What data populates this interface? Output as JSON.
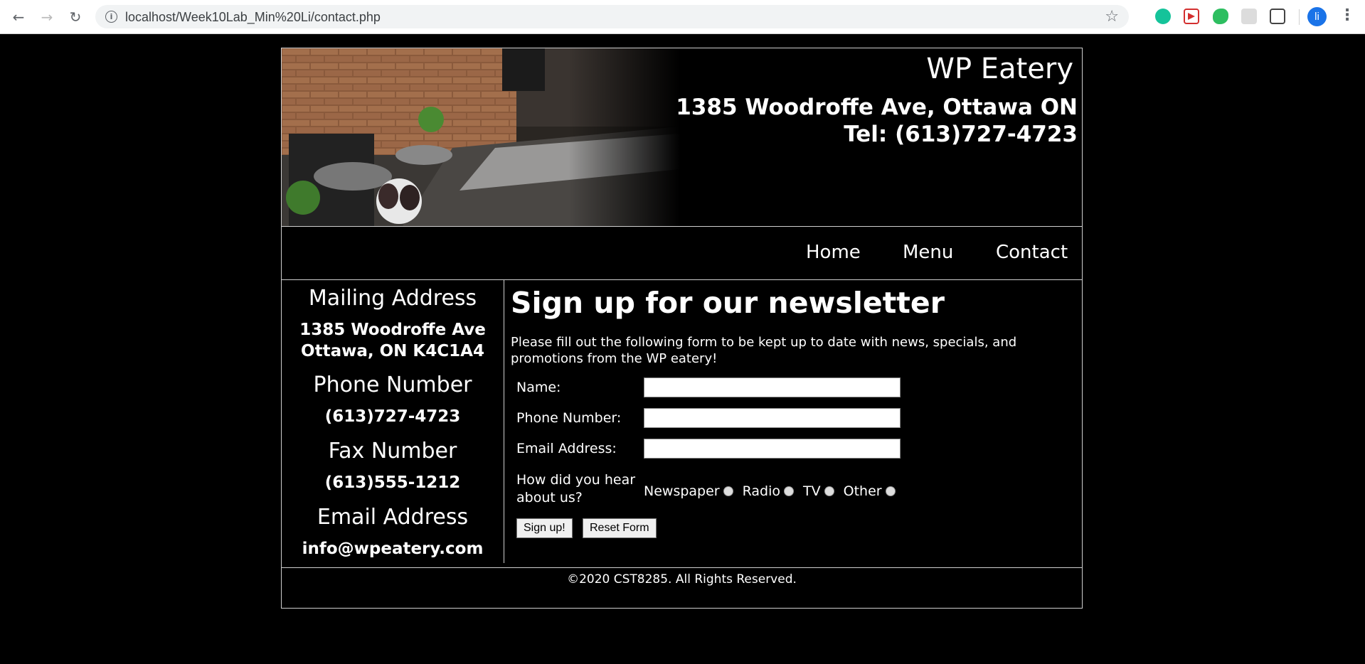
{
  "browser": {
    "url": "localhost/Week10Lab_Min%20Li/contact.php",
    "profile_initial": "li"
  },
  "header": {
    "brand": "WP Eatery",
    "address": "1385 Woodroffe Ave, Ottawa ON",
    "tel": "Tel: (613)727-4723"
  },
  "nav": {
    "items": [
      {
        "label": "Home"
      },
      {
        "label": "Menu"
      },
      {
        "label": "Contact"
      }
    ]
  },
  "sidebar": {
    "mailing_title": "Mailing Address",
    "mailing_line1": "1385 Woodroffe Ave",
    "mailing_line2": "Ottawa, ON K4C1A4",
    "phone_title": "Phone Number",
    "phone": "(613)727-4723",
    "fax_title": "Fax Number",
    "fax": "(613)555-1212",
    "email_title": "Email Address",
    "email": "info@wpeatery.com"
  },
  "form": {
    "heading": "Sign up for our newsletter",
    "intro": "Please fill out the following form to be kept up to date with news, specials, and promotions from the WP eatery!",
    "name_label": "Name:",
    "name_value": "",
    "phone_label": "Phone Number:",
    "phone_value": "",
    "email_label": "Email Address:",
    "email_value": "",
    "hear_label_line1": "How did you hear",
    "hear_label_line2": "about us?",
    "options": [
      "Newspaper",
      "Radio",
      "TV",
      "Other"
    ],
    "submit_label": "Sign up!",
    "reset_label": "Reset Form"
  },
  "footer": {
    "text": "©2020 CST8285. All Rights Reserved."
  }
}
